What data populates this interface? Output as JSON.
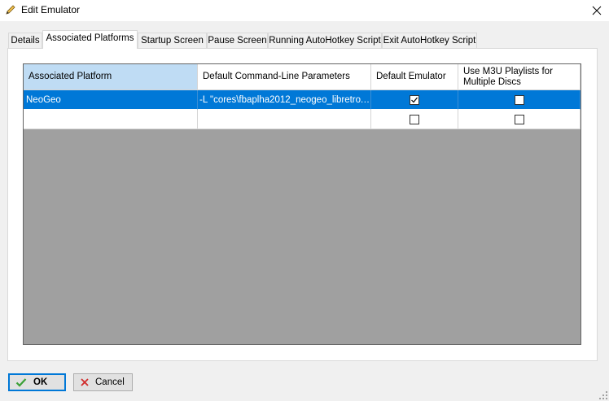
{
  "window": {
    "title": "Edit Emulator"
  },
  "tabs": [
    "Details",
    "Associated Platforms",
    "Startup Screen",
    "Pause Screen",
    "Running AutoHotkey Script",
    "Exit AutoHotkey Script"
  ],
  "grid": {
    "columns": [
      "Associated Platform",
      "Default Command-Line Parameters",
      "Default Emulator",
      "Use M3U Playlists for Multiple Discs"
    ],
    "rows": [
      {
        "platform": "NeoGeo",
        "params": "-L \"cores\\fbaplha2012_neogeo_libretro.…",
        "default_emulator": true,
        "use_m3u": false
      },
      {
        "platform": "",
        "params": "",
        "default_emulator": false,
        "use_m3u": false
      }
    ]
  },
  "buttons": {
    "ok": "OK",
    "cancel": "Cancel"
  },
  "colors": {
    "selection": "#0078d7",
    "header_selected": "#bfdcf4",
    "grid_background": "#a0a0a0"
  }
}
